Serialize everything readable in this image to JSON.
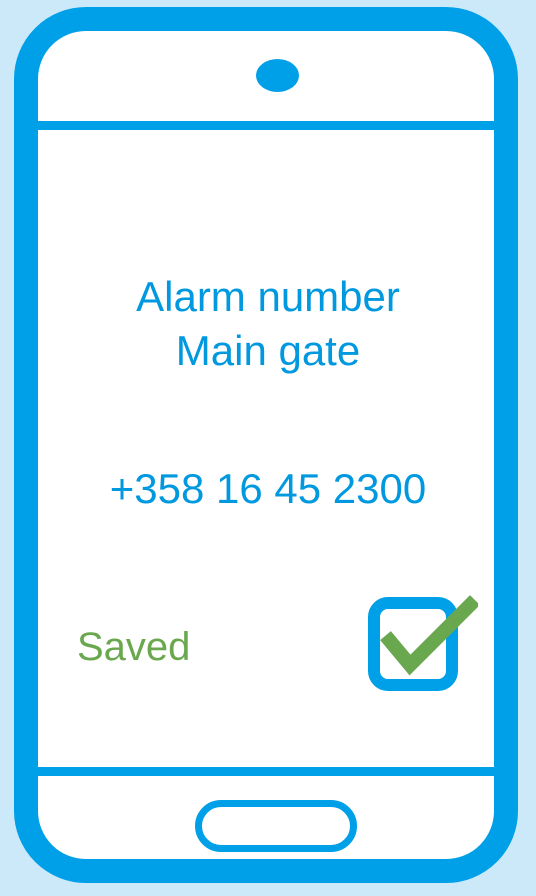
{
  "screen": {
    "title_line_1": "Alarm number",
    "title_line_2": "Main gate",
    "phone_number": "+358 16 45 2300",
    "status_text": "Saved"
  },
  "icons": {
    "camera": "camera-dot-icon",
    "home": "home-button-icon",
    "status": "checkbox-checked-icon"
  },
  "colors": {
    "background": "#cce9fa",
    "phone_frame": "#00a0e9",
    "text_primary": "#0098de",
    "success": "#6aa84f",
    "screen": "#ffffff"
  }
}
